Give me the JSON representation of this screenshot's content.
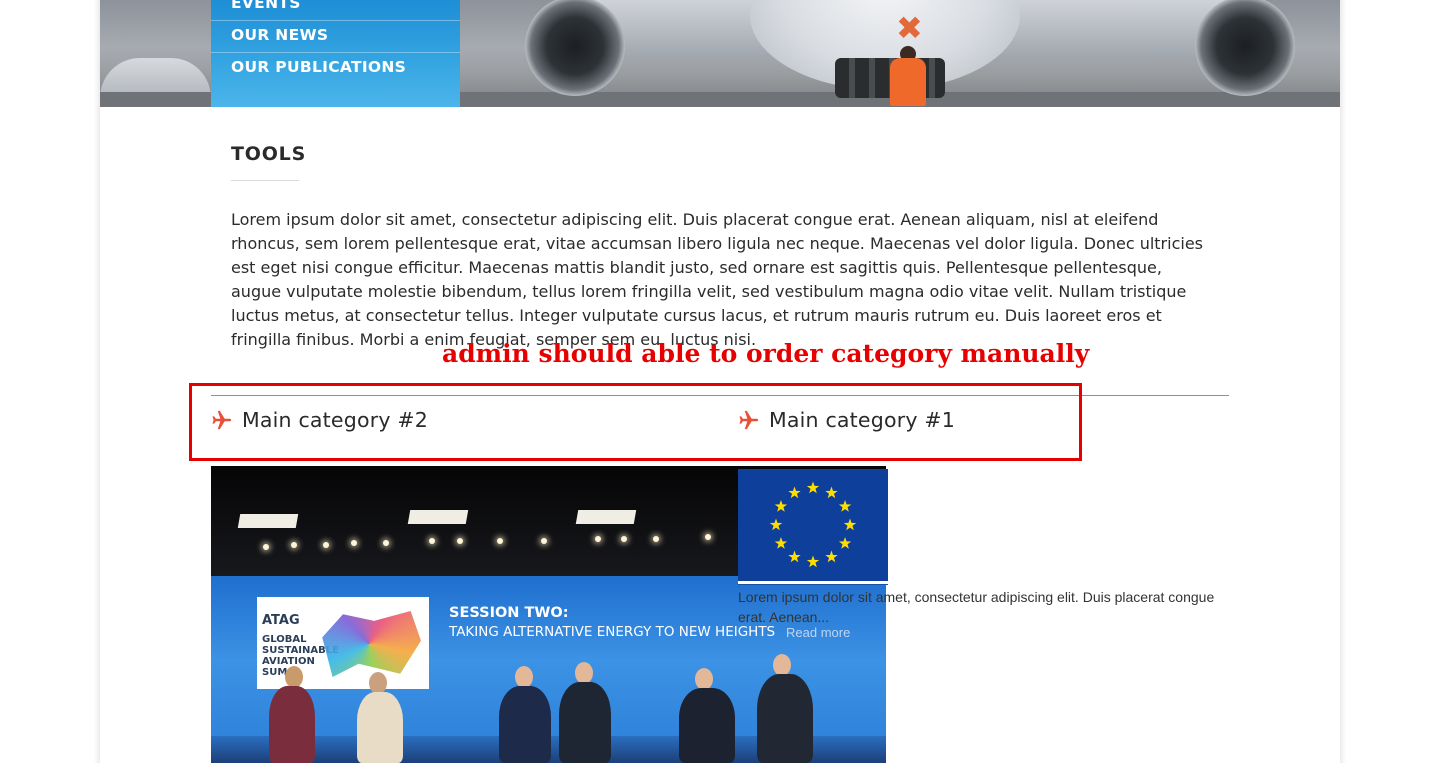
{
  "hero": {
    "nav": [
      {
        "label": "EVENTS"
      },
      {
        "label": "OUR NEWS"
      },
      {
        "label": "OUR PUBLICATIONS"
      }
    ]
  },
  "content": {
    "title": "TOOLS",
    "intro": "Lorem ipsum dolor sit amet, consectetur adipiscing elit. Duis placerat congue erat. Aenean aliquam, nisl at eleifend rhoncus, sem lorem pellentesque erat, vitae accumsan libero ligula nec neque. Maecenas vel dolor ligula. Donec ultricies est eget nisi congue efficitur. Maecenas mattis blandit justo, sed ornare est sagittis quis. Pellentesque pellentesque, augue vulputate molestie bibendum, tellus lorem fringilla velit, sed vestibulum magna odio vitae velit. Nullam tristique luctus metus, at consectetur tellus. Integer vulputate cursus lacus, et rutrum mauris rutrum eu. Duis laoreet eros et fringilla finibus. Morbi a enim feugiat, semper sem eu, luctus nisi."
  },
  "annotation": "admin should able to order category manually",
  "categories": [
    {
      "label": "Main category #2"
    },
    {
      "label": "Main category #1"
    }
  ],
  "photo": {
    "logo_line1": "ATAG",
    "logo_line2": "GLOBAL SUSTAINABLE AVIATION SUM",
    "session_title": "SESSION TWO:",
    "session_subtitle": "TAKING ALTERNATIVE ENERGY TO NEW HEIGHTS"
  },
  "post": {
    "excerpt": "Lorem ipsum dolor sit amet, consectetur adipiscing elit. Duis placerat congue erat. Aenean...",
    "read_more": "Read more"
  },
  "colors": {
    "accent_blue": "#2a9de0",
    "annotation_red": "#e60000",
    "plane_icon": "#e8503a",
    "eu_blue": "#0e3f9a",
    "eu_star": "#ffdd00"
  },
  "icons": {
    "category_icon": "airplane-icon"
  }
}
